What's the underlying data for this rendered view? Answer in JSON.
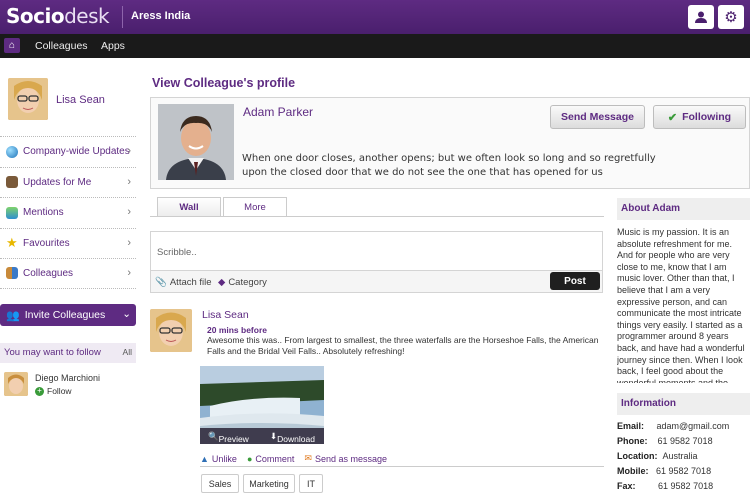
{
  "header": {
    "logo_bold": "Socio",
    "logo_light": "desk",
    "org_name": "Aress India"
  },
  "nav": {
    "items": [
      {
        "label": "Colleagues"
      },
      {
        "label": "Apps"
      }
    ]
  },
  "sidebar": {
    "user_name": "Lisa Sean",
    "items": [
      {
        "label": "Company-wide Updates",
        "icon": "globe-icon"
      },
      {
        "label": "Updates for Me",
        "icon": "person-icon"
      },
      {
        "label": "Mentions",
        "icon": "speech-bubble-icon"
      },
      {
        "label": "Favourites",
        "icon": "star-icon"
      },
      {
        "label": "Colleagues",
        "icon": "people-icon"
      }
    ],
    "invite_label": "Invite Colleagues",
    "follow_heading": "You may want to follow",
    "follow_all": "All",
    "suggestion": {
      "name": "Diego Marchioni",
      "follow_label": "Follow"
    }
  },
  "profile": {
    "section_title": "View Colleague's profile",
    "name": "Adam Parker",
    "quote": "When one door closes, another opens; but we often look so long and so regretfully upon the closed door that we do not see the one that has opened for us",
    "send_message_label": "Send Message",
    "following_label": "Following"
  },
  "tabs": [
    {
      "label": "Wall",
      "active": true
    },
    {
      "label": "More",
      "active": false
    }
  ],
  "composer": {
    "placeholder": "Scribble..",
    "attach_label": "Attach file",
    "category_label": "Category",
    "post_label": "Post"
  },
  "post": {
    "author": "Lisa Sean",
    "time": "20 mins before",
    "body": "Awesome this was.. From largest to smallest, the three waterfalls are the Horseshoe Falls, the American Falls and the Bridal Veil Falls.. Absolutely refreshing!",
    "preview_label": "Preview",
    "download_label": "Download",
    "actions": [
      {
        "label": "Unlike",
        "icon": "thumbs-up-icon"
      },
      {
        "label": "Comment",
        "icon": "comment-icon"
      },
      {
        "label": "Send as message",
        "icon": "envelope-icon"
      }
    ],
    "tags": [
      "Sales",
      "Marketing",
      "IT"
    ]
  },
  "about": {
    "heading": "About Adam",
    "text": "Music is my passion. It is an absolute refreshment for me. And for people who are very close to me, know that I am music lover. Other than that, I believe that I am a very expressive person, and can communicate the most intricate things very easily. I started as a programmer around 8 years back, and have had a wonderful journey since then. When I look back, I feel good about the wonderful moments and the promising associations."
  },
  "information": {
    "heading": "Information",
    "rows": [
      {
        "label": "Email:",
        "value": "adam@gmail.com"
      },
      {
        "label": "Phone:",
        "value": "61 9582 7018"
      },
      {
        "label": "Location:",
        "value": "Australia"
      },
      {
        "label": "Mobile:",
        "value": "61 9582 7018"
      },
      {
        "label": "Fax:",
        "value": "61 9582 7018"
      }
    ]
  },
  "colors": {
    "brand_purple": "#5e2b82",
    "nav_black": "#1a1a1a",
    "follow_green": "#3a9b3a"
  }
}
